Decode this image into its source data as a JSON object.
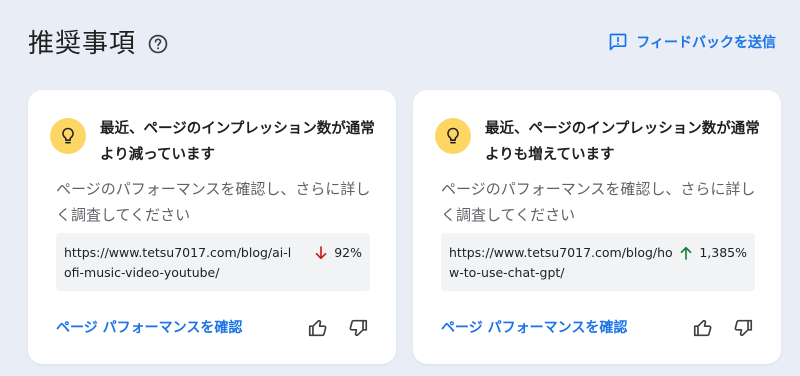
{
  "header": {
    "title": "推奨事項",
    "help_icon": "help-circle-icon",
    "feedback_label": "フィードバックを送信",
    "feedback_icon": "feedback-icon"
  },
  "colors": {
    "page_background": "#e8edf6",
    "card_background": "#ffffff",
    "accent_blue": "#1a73e8",
    "bulb_yellow": "#fdd663",
    "trend_down_red": "#c5221f",
    "trend_up_green": "#188038",
    "url_box_background": "#f1f3f4"
  },
  "cards": [
    {
      "icon": "lightbulb-icon",
      "title": "最近、ページのインプレッション数が通常より減っています",
      "description": "ページのパフォーマンスを確認し、さらに詳しく調査してください",
      "url": "https://www.tetsu7017.com/blog/ai-lofi-music-video-youtube/",
      "trend_direction": "down",
      "trend_icon": "arrow-down-icon",
      "trend_value": "92%",
      "link_label": "ページ パフォーマンスを確認",
      "thumbs_up_icon": "thumbs-up-icon",
      "thumbs_down_icon": "thumbs-down-icon"
    },
    {
      "icon": "lightbulb-icon",
      "title": "最近、ページのインプレッション数が通常よりも増えています",
      "description": "ページのパフォーマンスを確認し、さらに詳しく調査してください",
      "url": "https://www.tetsu7017.com/blog/how-to-use-chat-gpt/",
      "trend_direction": "up",
      "trend_icon": "arrow-up-icon",
      "trend_value": "1,385%",
      "link_label": "ページ パフォーマンスを確認",
      "thumbs_up_icon": "thumbs-up-icon",
      "thumbs_down_icon": "thumbs-down-icon"
    }
  ]
}
